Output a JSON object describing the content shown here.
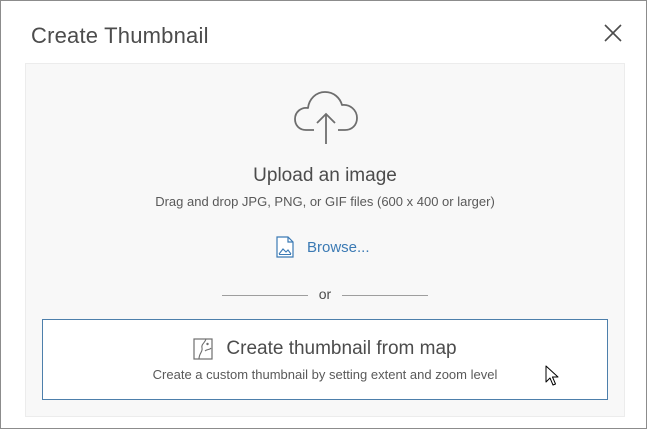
{
  "dialog": {
    "title": "Create Thumbnail",
    "close_icon": "close-icon"
  },
  "upload": {
    "icon": "cloud-upload-icon",
    "title": "Upload an image",
    "subtitle": "Drag and drop JPG, PNG, or GIF files (600 x 400 or larger)",
    "browse_icon": "image-file-icon",
    "browse_label": "Browse..."
  },
  "divider": {
    "label": "or"
  },
  "map_option": {
    "icon": "map-icon",
    "title": "Create thumbnail from map",
    "subtitle": "Create a custom thumbnail by setting extent and zoom level"
  },
  "colors": {
    "link": "#3b7ab4",
    "button_border": "#4d7fab",
    "panel_bg": "#f8f8f8",
    "text": "#4c4c4c"
  }
}
